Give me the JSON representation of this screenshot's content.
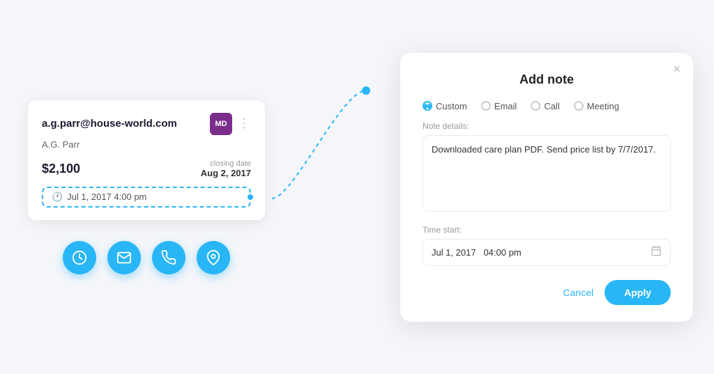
{
  "page": {
    "bg_color": "#f4f6fa"
  },
  "contact_card": {
    "email": "a.g.parr@house-world.com",
    "name": "A.G. Parr",
    "avatar_initials": "MD",
    "avatar_color": "#7b2d8b",
    "price": "$2,100",
    "closing_label": "closing date",
    "closing_date": "Aug 2, 2017",
    "date_badge": "Jul 1, 2017  4:00 pm"
  },
  "action_icons": {
    "clock": "🕐",
    "email": "✉",
    "phone": "📞",
    "location": "📍"
  },
  "add_note_panel": {
    "title": "Add note",
    "close_icon": "×",
    "note_types": [
      {
        "id": "custom",
        "label": "Custom",
        "selected": true
      },
      {
        "id": "email",
        "label": "Email",
        "selected": false
      },
      {
        "id": "call",
        "label": "Call",
        "selected": false
      },
      {
        "id": "meeting",
        "label": "Meeting",
        "selected": false
      }
    ],
    "note_details_label": "Note details:",
    "note_placeholder": "",
    "note_value": "Downloaded care plan PDF. Send price list by 7/7/2017.",
    "time_start_label": "Time start:",
    "time_value": "Jul 1, 2017   04:00 pm",
    "cancel_label": "Cancel",
    "apply_label": "Apply"
  }
}
